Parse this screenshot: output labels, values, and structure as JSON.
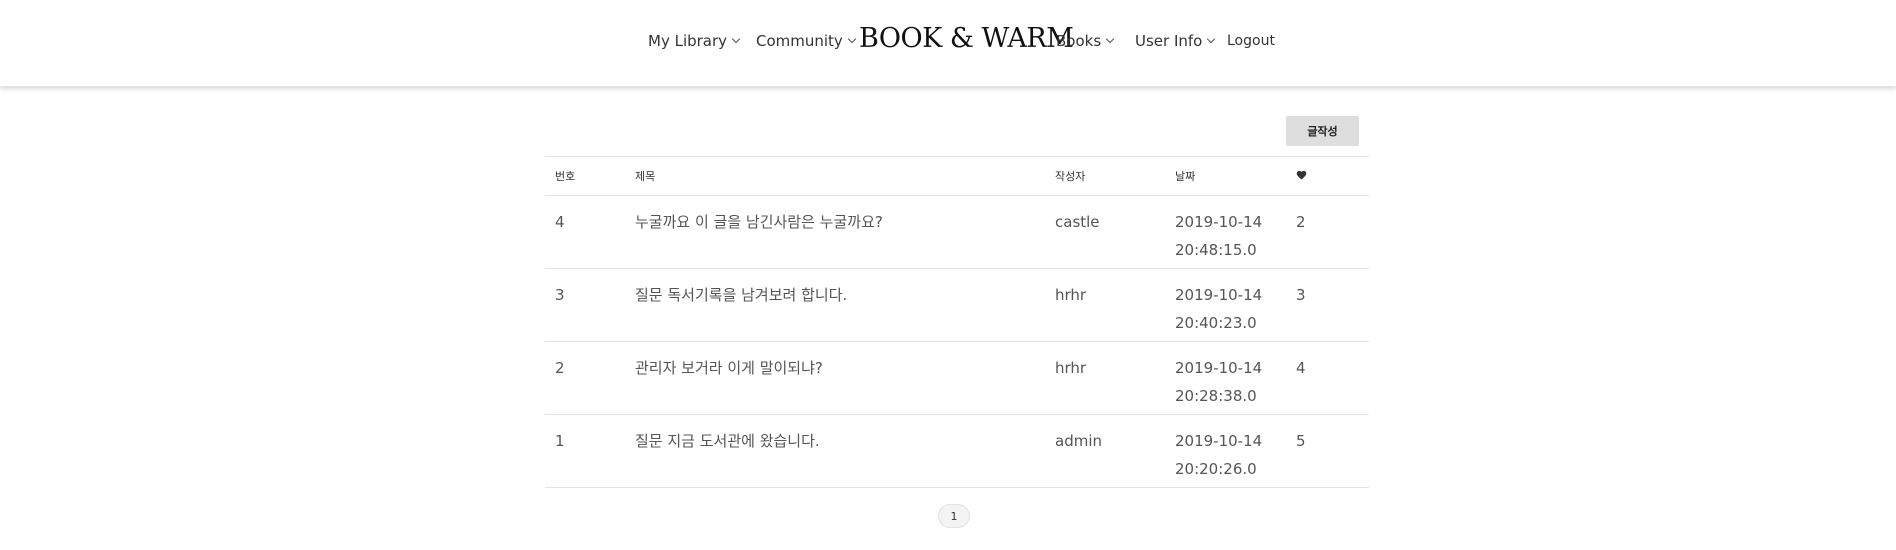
{
  "nav": {
    "brand": "BOOK & WARM",
    "items": [
      {
        "label": "My Library",
        "dropdown": true
      },
      {
        "label": "Community",
        "dropdown": true
      },
      {
        "label": "Books",
        "dropdown": true
      },
      {
        "label": "User Info",
        "dropdown": true
      },
      {
        "label": "Logout",
        "dropdown": false
      }
    ]
  },
  "board": {
    "write_button": "글작성",
    "headers": {
      "number": "번호",
      "title": "제목",
      "writer": "작성자",
      "date": "날짜",
      "likes_icon": "heart-icon"
    },
    "rows": [
      {
        "number": "4",
        "title": "누굴까요 이 글을 남긴사람은 누굴까요?",
        "writer": "castle",
        "date": "2019-10-14",
        "time": "20:48:15.0",
        "likes": "2"
      },
      {
        "number": "3",
        "title": "질문 독서기록을 남겨보려 합니다.",
        "writer": "hrhr",
        "date": "2019-10-14",
        "time": "20:40:23.0",
        "likes": "3"
      },
      {
        "number": "2",
        "title": "관리자 보거라 이게 말이되냐?",
        "writer": "hrhr",
        "date": "2019-10-14",
        "time": "20:28:38.0",
        "likes": "4"
      },
      {
        "number": "1",
        "title": "질문 지금 도서관에 왔습니다.",
        "writer": "admin",
        "date": "2019-10-14",
        "time": "20:20:26.0",
        "likes": "5"
      }
    ]
  },
  "pagination": {
    "current_page": "1"
  }
}
